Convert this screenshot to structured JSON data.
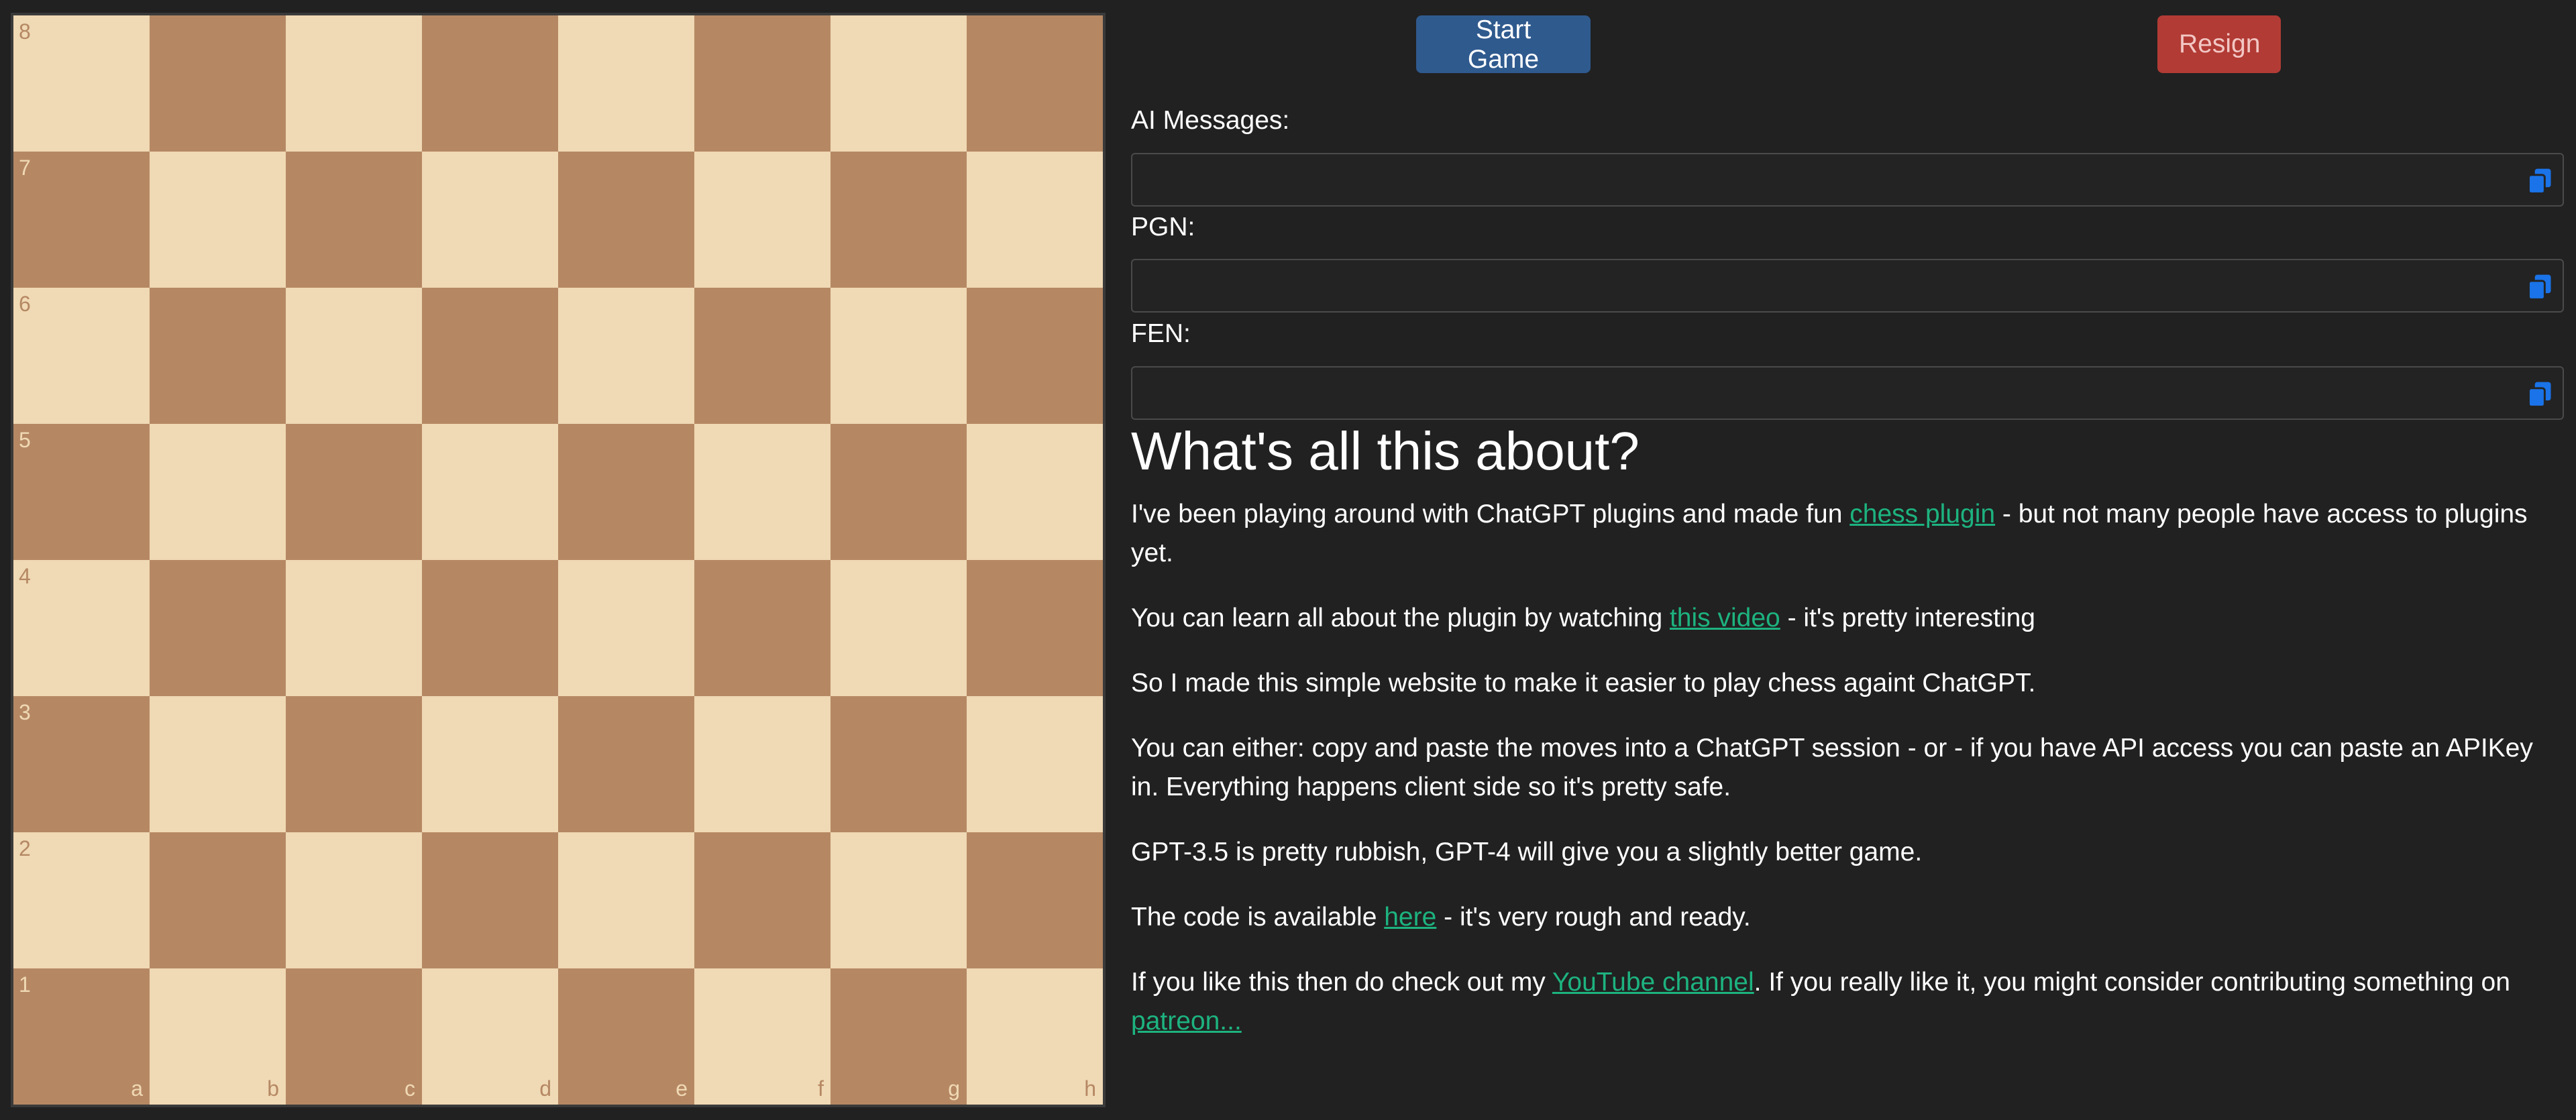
{
  "board": {
    "ranks": [
      "8",
      "7",
      "6",
      "5",
      "4",
      "3",
      "2",
      "1"
    ],
    "files": [
      "a",
      "b",
      "c",
      "d",
      "e",
      "f",
      "g",
      "h"
    ],
    "light_color": "#f0d9b5",
    "dark_color": "#b58863"
  },
  "controls": {
    "start_label": "Start Game",
    "resign_label": "Resign",
    "start_color": "#2f5a8e",
    "resign_color": "#b23b35"
  },
  "fields": {
    "ai_messages": {
      "label": "AI Messages:",
      "value": ""
    },
    "pgn": {
      "label": "PGN:",
      "value": ""
    },
    "fen": {
      "label": "FEN:",
      "value": ""
    }
  },
  "about": {
    "heading": "What's all this about?",
    "p1": {
      "pre": "I've been playing around with ChatGPT plugins and made fun ",
      "link": "chess plugin",
      "post": " - but not many people have access to plugins yet."
    },
    "p2": {
      "pre": "You can learn all about the plugin by watching ",
      "link": "this video",
      "post": " - it's pretty interesting"
    },
    "p3": "So I made this simple website to make it easier to play chess againt ChatGPT.",
    "p4": "You can either: copy and paste the moves into a ChatGPT session - or - if you have API access you can paste an APIKey in. Everything happens client side so it's pretty safe.",
    "p5": "GPT-3.5 is pretty rubbish, GPT-4 will give you a slightly better game.",
    "p6": {
      "pre": "The code is available ",
      "link": "here",
      "post": " - it's very rough and ready."
    },
    "p7": {
      "pre": "If you like this then do check out my ",
      "link1": "YouTube channel",
      "mid": ". If you really like it, you might consider contributing something on ",
      "link2": "patreon..."
    },
    "link_color": "#1db37f"
  },
  "icons": {
    "copy": "copy-icon",
    "copy_color": "#1a73e8"
  }
}
